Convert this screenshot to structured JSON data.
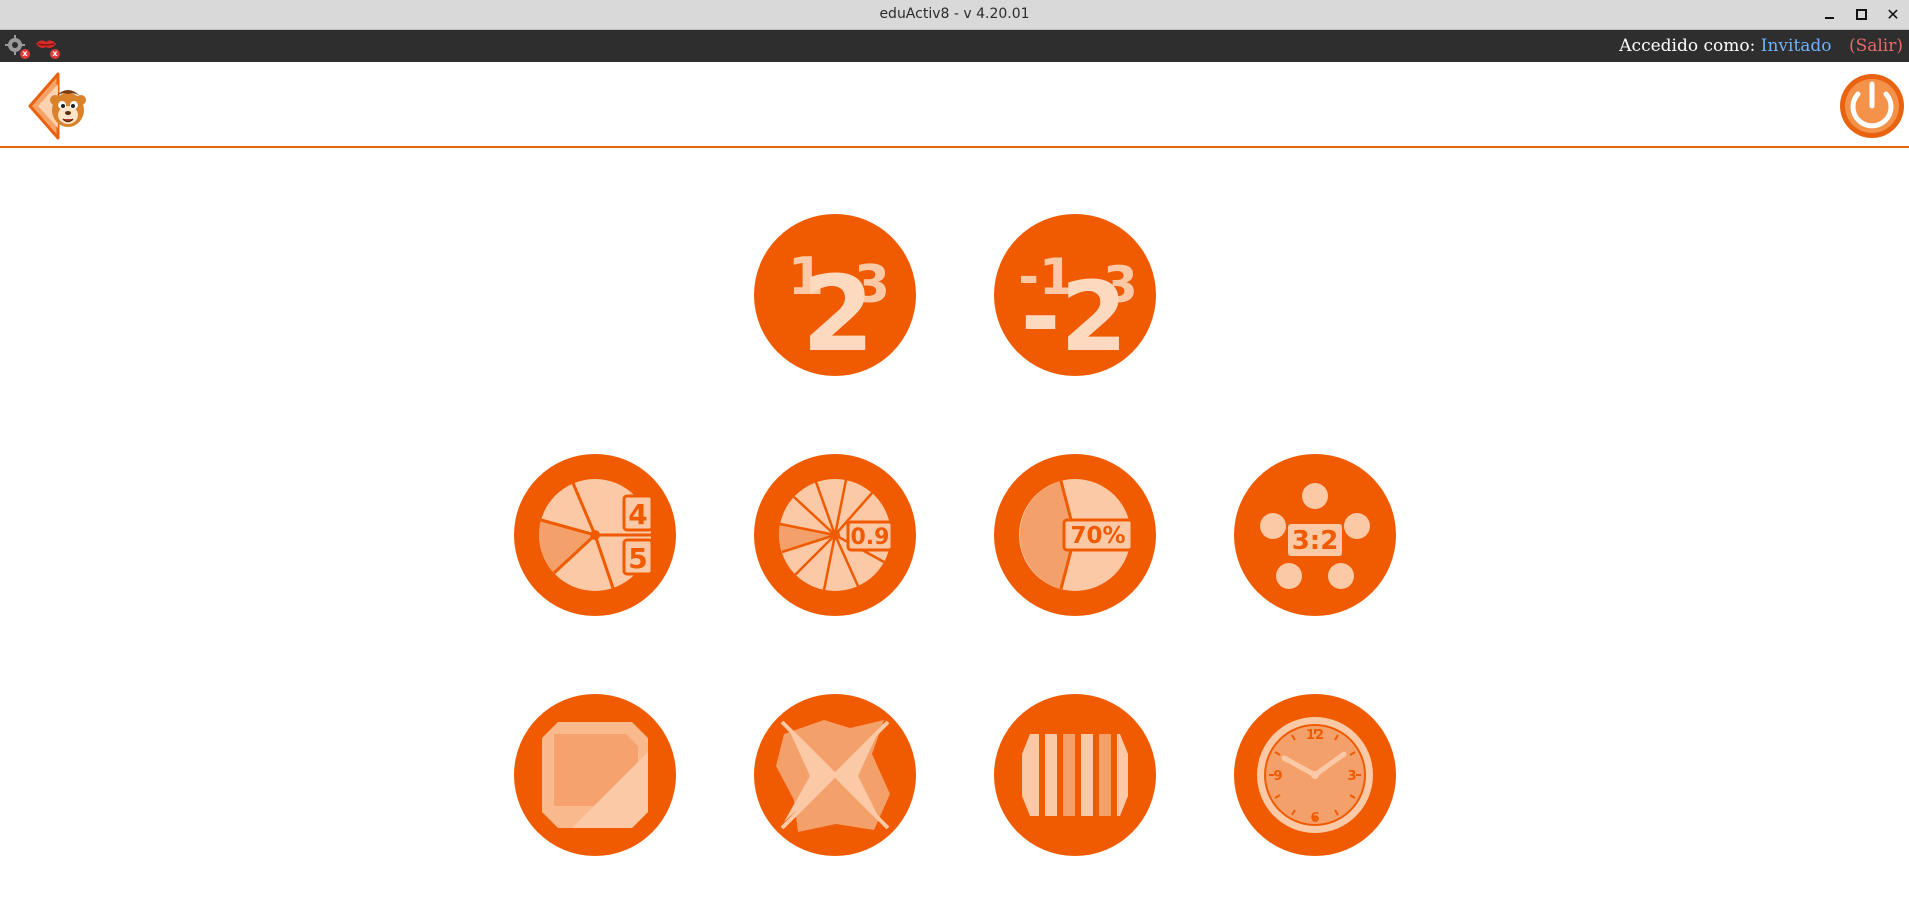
{
  "window": {
    "title": "eduActiv8 - v 4.20.01"
  },
  "statusbar": {
    "logged_as_label": "Accedido como:",
    "user_name": "Invitado",
    "logout_label": "(Salir)",
    "icons": [
      "settings-disconnected-icon",
      "speech-disconnected-icon"
    ]
  },
  "header": {
    "back_icon": "mascot-back-arrow-icon",
    "power_icon": "power-icon"
  },
  "colors": {
    "accent": "#f05a00",
    "light": "#fbc9a6",
    "mid": "#f4a06b",
    "statusbar_bg": "#2e2e2e",
    "user_link": "#6db3ff",
    "logout_link": "#e36b6b",
    "rule": "#e8620f"
  },
  "activities": {
    "row1": {
      "addition": {
        "digits_small": [
          "1",
          "3"
        ],
        "digit_big": "2"
      },
      "subtraction": {
        "digits_small": [
          "-1",
          "-3"
        ],
        "digit_big": "-2"
      }
    },
    "row2": {
      "fractions": {
        "top": "4",
        "bottom": "5"
      },
      "decimals": {
        "label": "0.9"
      },
      "percentages": {
        "label": "70%"
      },
      "ratios": {
        "label": "3:2"
      }
    },
    "row3": {
      "shapes": {
        "icon": "shape-overlap-icon"
      },
      "symmetry": {
        "icon": "symmetry-cross-icon"
      },
      "bars": {
        "icon": "vertical-bars-icon"
      },
      "clock": {
        "n12": "12",
        "n3": "3",
        "n6": "6",
        "n9": "9"
      }
    }
  }
}
